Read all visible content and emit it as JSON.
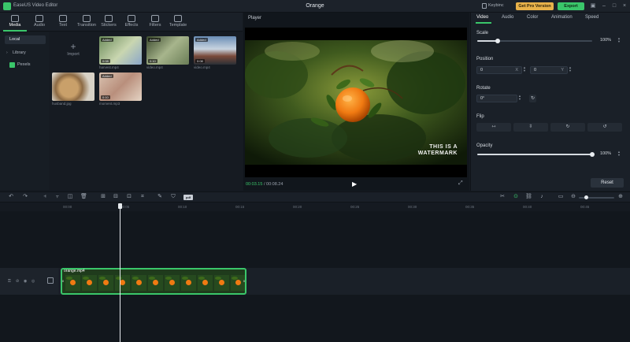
{
  "titlebar": {
    "app_name": "EaseUS Video Editor",
    "doc_title": "Orange",
    "keybind_label": "Keybinc",
    "pro_label": "Get Pro Version",
    "export_label": "Export",
    "accent": "#3ac66a"
  },
  "toolbar": {
    "tools": [
      {
        "label": "Media",
        "icon": "media-icon"
      },
      {
        "label": "Audio",
        "icon": "music-note-icon"
      },
      {
        "label": "Text",
        "icon": "text-icon"
      },
      {
        "label": "Transition",
        "icon": "transition-icon"
      },
      {
        "label": "Stickers",
        "icon": "sticker-icon"
      },
      {
        "label": "Effects",
        "icon": "effects-icon"
      },
      {
        "label": "Filters",
        "icon": "filter-icon"
      },
      {
        "label": "Template",
        "icon": "template-icon"
      }
    ]
  },
  "media_nav": {
    "items": [
      {
        "label": "Local"
      },
      {
        "label": "Library"
      },
      {
        "label": "Pexels"
      }
    ]
  },
  "media": {
    "import_label": "Import",
    "items": [
      {
        "caption": "harvest.mp4",
        "badge": "Added",
        "duration": "0:08"
      },
      {
        "caption": "video.mp4",
        "badge": "Added",
        "duration": "0:10"
      },
      {
        "caption": "video.mp4",
        "badge": "Added",
        "duration": "0:08"
      },
      {
        "caption": "husband.jpg",
        "badge": "",
        "duration": ""
      },
      {
        "caption": "moment.mp3",
        "badge": "Added",
        "duration": "0:10"
      }
    ]
  },
  "player": {
    "title": "Player",
    "watermark_line1": "THIS IS A",
    "watermark_line2": "WATERMARK",
    "time_current": "00:03.15",
    "time_total": "00:08.24"
  },
  "props": {
    "tabs": [
      {
        "label": "Video"
      },
      {
        "label": "Audio"
      },
      {
        "label": "Color"
      },
      {
        "label": "Animation"
      },
      {
        "label": "Speed"
      }
    ],
    "scale_label": "Scale",
    "scale_value": "100%",
    "scale_fraction": 0.18,
    "position_label": "Position",
    "pos_x": "0",
    "pos_x_unit": "X",
    "pos_y": "0",
    "pos_y_unit": "Y",
    "rotate_label": "Rotate",
    "rotate_value": "0°",
    "flip_label": "Flip",
    "opacity_label": "Opacity",
    "opacity_value": "100%",
    "opacity_fraction": 1.0,
    "reset_label": "Reset"
  },
  "timeline": {
    "pdf_chip": "pdf",
    "ruler_labels": [
      "00:00",
      "00:05",
      "00:10",
      "00:15",
      "00:20",
      "00:25",
      "00:30",
      "00:35",
      "00:40",
      "00:45"
    ],
    "clip_name": "orange.mp4"
  }
}
